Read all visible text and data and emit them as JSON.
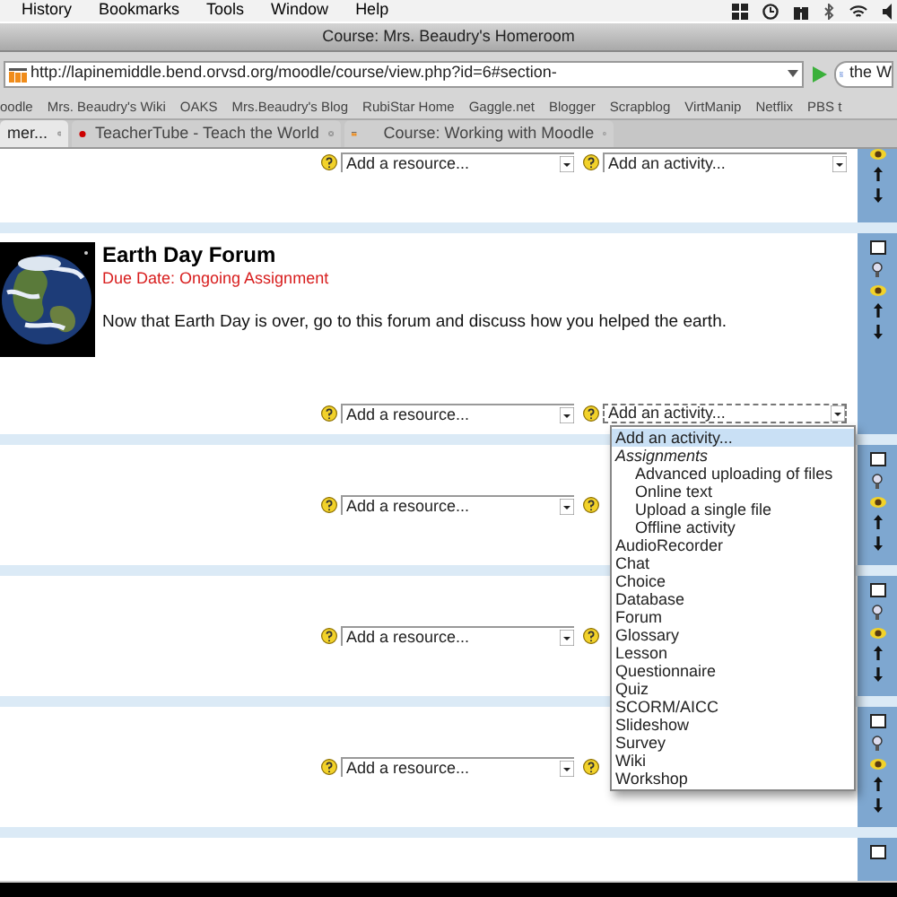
{
  "menubar": {
    "items": [
      "History",
      "Bookmarks",
      "Tools",
      "Window",
      "Help"
    ]
  },
  "window": {
    "title": "Course: Mrs. Beaudry's Homeroom"
  },
  "address_bar": {
    "url": "http://lapinemiddle.bend.orvsd.org/moodle/course/view.php?id=6#section-",
    "search_value": "the W"
  },
  "bookmarks": [
    "oodle",
    "Mrs. Beaudry's Wiki",
    "OAKS",
    "Mrs.Beaudry's Blog",
    "RubiStar Home",
    "Gaggle.net",
    "Blogger",
    "Scrapblog",
    "VirtManip",
    "Netflix",
    "PBS t"
  ],
  "tabs": [
    {
      "label": "mer...",
      "selected": true
    },
    {
      "label": "TeacherTube - Teach the World",
      "selected": false
    },
    {
      "label": "Course: Working with Moodle",
      "selected": false
    }
  ],
  "sections": [
    {
      "kind": "cut",
      "resource": "Add a resource...",
      "activity": "Add an activity..."
    },
    {
      "kind": "forum",
      "title": "Earth Day Forum",
      "due": "Due Date: Ongoing Assignment",
      "description": "Now that Earth Day is over, go to this forum and discuss how you helped the earth.",
      "resource": "Add a resource...",
      "activity": "Add an activity..."
    },
    {
      "kind": "empty",
      "resource": "Add a resource..."
    },
    {
      "kind": "empty",
      "resource": "Add a resource..."
    },
    {
      "kind": "empty",
      "resource": "Add a resource..."
    },
    {
      "kind": "tail"
    }
  ],
  "activity_menu": [
    {
      "label": "Add an activity...",
      "kind": "option",
      "selected": true
    },
    {
      "label": "Assignments",
      "kind": "group",
      "selected": false
    },
    {
      "label": "Advanced uploading of files",
      "kind": "child",
      "selected": false
    },
    {
      "label": "Online text",
      "kind": "child",
      "selected": false
    },
    {
      "label": "Upload a single file",
      "kind": "child",
      "selected": false
    },
    {
      "label": "Offline activity",
      "kind": "child",
      "selected": false
    },
    {
      "label": "AudioRecorder",
      "kind": "option",
      "selected": false
    },
    {
      "label": "Chat",
      "kind": "option",
      "selected": false
    },
    {
      "label": "Choice",
      "kind": "option",
      "selected": false
    },
    {
      "label": "Database",
      "kind": "option",
      "selected": false
    },
    {
      "label": "Forum",
      "kind": "option",
      "selected": false
    },
    {
      "label": "Glossary",
      "kind": "option",
      "selected": false
    },
    {
      "label": "Lesson",
      "kind": "option",
      "selected": false
    },
    {
      "label": "Questionnaire",
      "kind": "option",
      "selected": false
    },
    {
      "label": "Quiz",
      "kind": "option",
      "selected": false
    },
    {
      "label": "SCORM/AICC",
      "kind": "option",
      "selected": false
    },
    {
      "label": "Slideshow",
      "kind": "option",
      "selected": false
    },
    {
      "label": "Survey",
      "kind": "option",
      "selected": false
    },
    {
      "label": "Wiki",
      "kind": "option",
      "selected": false
    },
    {
      "label": "Workshop",
      "kind": "option",
      "selected": false
    }
  ]
}
